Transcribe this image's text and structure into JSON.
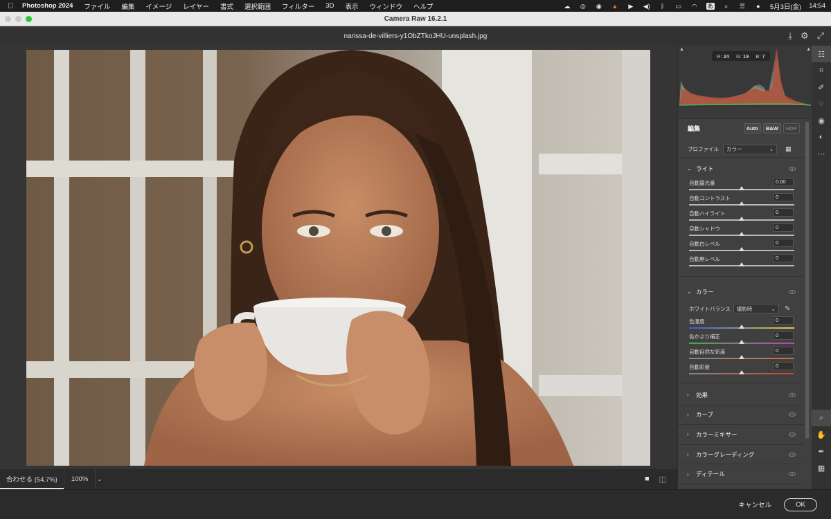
{
  "menubar": {
    "app": "Photoshop 2024",
    "items": [
      "ファイル",
      "編集",
      "イメージ",
      "レイヤー",
      "書式",
      "選択範囲",
      "フィルター",
      "3D",
      "表示",
      "ウィンドウ",
      "ヘルプ"
    ],
    "input_mode": "あ",
    "date": "5月3日(金)",
    "time": "14:54"
  },
  "window": {
    "title": "Camera Raw 16.2.1",
    "filename": "narissa-de-villiers-y1ObZTkoJHU-unsplash.jpg"
  },
  "histogram": {
    "r_label": "R:",
    "r": "24",
    "g_label": "G:",
    "g": "19",
    "b_label": "B:",
    "b": "7"
  },
  "edit": {
    "title": "編集",
    "auto": "Auto",
    "bw": "B&W",
    "hdr": "HDR",
    "profile_label": "プロファイル",
    "profile_value": "カラー"
  },
  "light": {
    "title": "ライト",
    "sliders": [
      {
        "label": "自動露光量",
        "value": "0.00",
        "pos": 0.5
      },
      {
        "label": "自動コントラスト",
        "value": "0",
        "pos": 0.5
      },
      {
        "label": "自動ハイライト",
        "value": "0",
        "pos": 0.5
      },
      {
        "label": "自動シャドウ",
        "value": "0",
        "pos": 0.5
      },
      {
        "label": "自動白レベル",
        "value": "0",
        "pos": 0.5
      },
      {
        "label": "自動黒レベル",
        "value": "0",
        "pos": 0.5
      }
    ]
  },
  "color": {
    "title": "カラー",
    "wb_label": "ホワイトバランス",
    "wb_value": "撮影時",
    "sliders": [
      {
        "label": "色温度",
        "value": "0",
        "pos": 0.5
      },
      {
        "label": "色かぶり補正",
        "value": "0",
        "pos": 0.5
      },
      {
        "label": "自動自然な彩度",
        "value": "0",
        "pos": 0.5
      },
      {
        "label": "自動彩度",
        "value": "0",
        "pos": 0.5
      }
    ]
  },
  "collapsed_sections": [
    "効果",
    "カーブ",
    "カラーミキサー",
    "カラーグレーディング",
    "ディテール"
  ],
  "bottom": {
    "zoom_fit": "合わせる (54.7%)",
    "zoom_100": "100%"
  },
  "footer": {
    "cancel": "キャンセル",
    "ok": "OK"
  },
  "colors": {
    "accent": "#e6e6e6",
    "panel_bg": "#404040",
    "traffic_red": "#ff5f57",
    "traffic_yellow": "#febc2e",
    "traffic_green": "#28c840"
  }
}
